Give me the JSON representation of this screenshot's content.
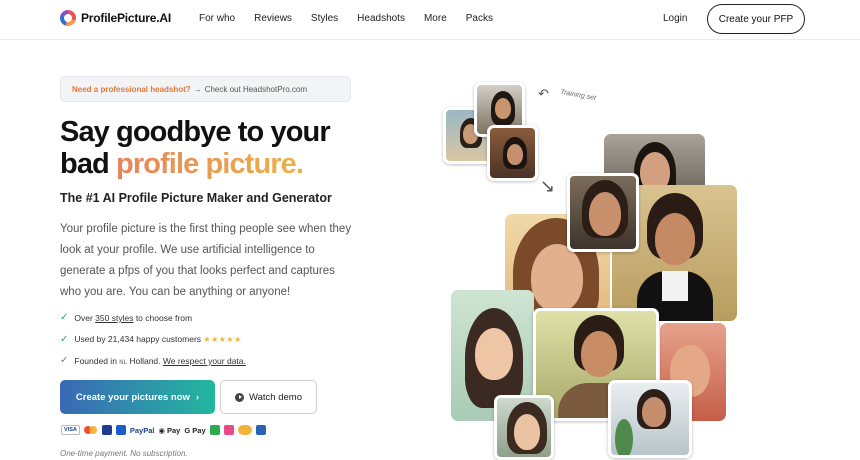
{
  "brand": {
    "name": "ProfilePicture.AI"
  },
  "nav": {
    "items": [
      "For who",
      "Reviews",
      "Styles",
      "Headshots",
      "More",
      "Packs"
    ],
    "login": "Login",
    "cta": "Create your PFP"
  },
  "notice": {
    "highlight": "Need a professional headshot?",
    "arrow": "→",
    "text": "Check out HeadshotPro.com"
  },
  "hero": {
    "title_line1": "Say goodbye to your",
    "title_line2_plain": "bad ",
    "title_line2_accent": "profile picture.",
    "subtitle": "The #1 AI Profile Picture Maker and Generator",
    "description": "Your profile picture is the first thing people see when they look at your profile. We use artificial intelligence to generate a pfps of you that looks perfect and captures who you are. You can be anything or anyone!"
  },
  "features": [
    {
      "pre": "Over ",
      "link": "350 styles",
      "post": " to choose from"
    },
    {
      "pre": "Used by 21,434 happy customers ",
      "stars": "★★★★★"
    },
    {
      "pre": "Founded in ",
      "flag": "NL",
      "mid": " Holland. ",
      "link": "We respect your data."
    }
  ],
  "buttons": {
    "primary": "Create your pictures now",
    "primary_arrow": "›",
    "secondary": "Watch demo"
  },
  "payments": [
    "VISA",
    "PayPal",
    "Pay",
    "G Pay"
  ],
  "footnote": "One-time payment. No subscription.",
  "collage": {
    "training_label": "Training set"
  },
  "colors": {
    "accent_start": "#e8825a",
    "accent_end": "#eab44a",
    "button_start": "#3a68b5",
    "button_end": "#22b7a0",
    "check": "#2fa36b",
    "stars": "#f2b33d"
  }
}
